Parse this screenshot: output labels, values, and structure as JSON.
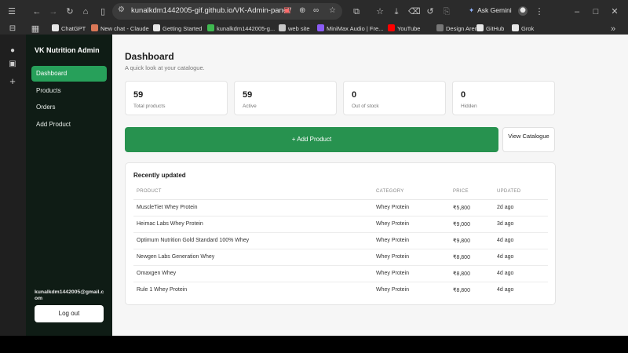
{
  "browser": {
    "url": "kunalkdm1442005-gif.github.io/VK-Admin-panel/",
    "ask_gemini": "Ask Gemini",
    "bookmarks": [
      {
        "label": "ChatGPT",
        "color": "#e8e8e8"
      },
      {
        "label": "New chat - Claude",
        "color": "#d97757"
      },
      {
        "label": "Getting Started",
        "color": "#e8e8e8"
      },
      {
        "label": "kunalkdm1442005-g...",
        "color": "#3fb950"
      },
      {
        "label": "web site",
        "color": "#c7c7c7"
      },
      {
        "label": "MiniMax Audio | Fre...",
        "color": "#8b5cf6"
      },
      {
        "label": "YouTube",
        "color": "#ff0000"
      },
      {
        "label": "Design Arena",
        "color": "#777777"
      },
      {
        "label": "GitHub",
        "color": "#e8e8e8"
      },
      {
        "label": "Grok",
        "color": "#e8e8e8"
      }
    ]
  },
  "sidebar": {
    "title": "VK Nutrition Admin",
    "items": [
      {
        "label": "Dashboard",
        "active": true
      },
      {
        "label": "Products",
        "active": false
      },
      {
        "label": "Orders",
        "active": false
      },
      {
        "label": "Add Product",
        "active": false
      }
    ],
    "email": "kunalkdm1442005@gmail.com",
    "logout_label": "Log out"
  },
  "main": {
    "title": "Dashboard",
    "subtitle": "A quick look at your catalogue.",
    "stats": [
      {
        "value": "59",
        "label": "Total products"
      },
      {
        "value": "59",
        "label": "Active"
      },
      {
        "value": "0",
        "label": "Out of stock"
      },
      {
        "value": "0",
        "label": "Hidden"
      }
    ],
    "add_product_label": "+ Add Product",
    "view_catalogue_label": "View Catalogue",
    "recent": {
      "title": "Recently updated",
      "columns": [
        "PRODUCT",
        "CATEGORY",
        "PRICE",
        "UPDATED"
      ],
      "rows": [
        [
          "MuscleTiet Whey Protein",
          "Whey Protein",
          "₹5,800",
          "2d ago"
        ],
        [
          "Heimac Labs Whey Protein",
          "Whey Protein",
          "₹9,000",
          "3d ago"
        ],
        [
          "Optimum Nutrition Gold Standard 100% Whey",
          "Whey Protein",
          "₹9,800",
          "4d ago"
        ],
        [
          "Newgen Labs Generation Whey",
          "Whey Protein",
          "₹8,800",
          "4d ago"
        ],
        [
          "Omaxgen Whey",
          "Whey Protein",
          "₹8,800",
          "4d ago"
        ],
        [
          "Rule 1 Whey Protein",
          "Whey Protein",
          "₹8,800",
          "4d ago"
        ]
      ]
    }
  },
  "colors": {
    "accent": "#27a05a",
    "sidebar_bg": "#0f1c15",
    "main_bg": "#f6f6f6"
  }
}
